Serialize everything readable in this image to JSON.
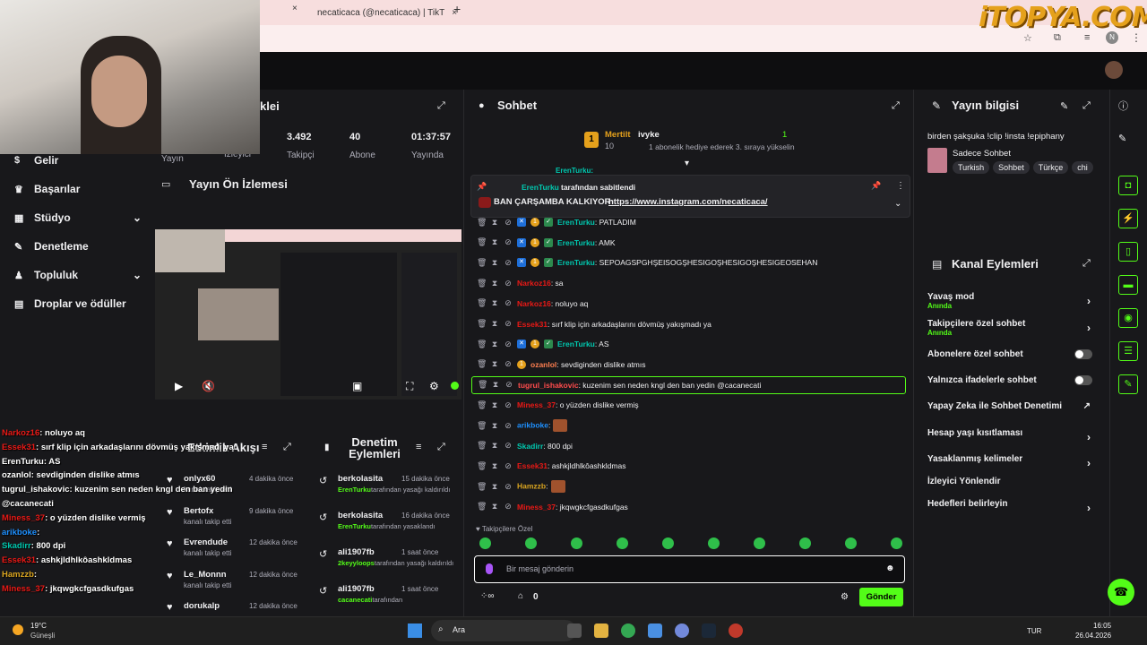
{
  "browser": {
    "tab2_title": "necaticaca (@necaticaca) | TikT",
    "new_tab": "+",
    "close": "×"
  },
  "logo": "iTOPYA.COM",
  "nav": {
    "items": [
      "Gelir",
      "Başarılar",
      "Stüdyo",
      "Denetleme",
      "Topluluk",
      "Droplar ve ödüller"
    ]
  },
  "stats": {
    "heading": "klei",
    "v1": "3.492",
    "l1": "Takipçi",
    "v2": "40",
    "l2": "Abone",
    "v3": "01:37:57",
    "l3": "Yayında",
    "l0": "Yayın",
    "l00": "İzleyici"
  },
  "preview": {
    "title": "Yayın Ön İzlemesi"
  },
  "activity": {
    "title": "Etkinlik Akışı",
    "items": [
      {
        "name": "onlyx60",
        "sub": "kanalı takip etti",
        "time": "4 dakika önce"
      },
      {
        "name": "Bertofx",
        "sub": "kanalı takip etti",
        "time": "9 dakika önce"
      },
      {
        "name": "Evrendude",
        "sub": "kanalı takip etti",
        "time": "12 dakika önce"
      },
      {
        "name": "Le_Monnn",
        "sub": "kanalı takip etti",
        "time": "12 dakika önce"
      },
      {
        "name": "dorukalp",
        "sub": "",
        "time": "12 dakika önce"
      }
    ]
  },
  "modlog": {
    "title": "Denetim Eylemleri",
    "items": [
      {
        "name": "berkolasita",
        "time": "15 dakika önce",
        "actor": "ErenTurku",
        "text": "tarafından yasağı kaldırıldı"
      },
      {
        "name": "berkolasita",
        "time": "16 dakika önce",
        "actor": "ErenTurku",
        "text": "tarafından yasaklandı"
      },
      {
        "name": "ali1907fb",
        "time": "1 saat önce",
        "actor": "2keyyloops",
        "text": "tarafından yasağı kaldırıldı"
      },
      {
        "name": "ali1907fb",
        "time": "1 saat önce",
        "actor": "cacanecati",
        "text": "tarafından"
      }
    ]
  },
  "chat": {
    "title": "Sohbet",
    "top_user": "Mertilt",
    "top_rank": "1",
    "top_count": "10",
    "top_gift_user": "ivyke",
    "top_gift_text": "1 abonelik hediye ederek 3. sıraya yükselin",
    "top_gift_count": "1",
    "pinned_by": "ErenTurku",
    "pinned_suffix": "tarafından sabitlendi",
    "pinned_msg": "BAN ÇARŞAMBA KALKIYOR",
    "pinned_link": "https://www.instagram.com/necaticaca/",
    "partial_user": "ErenTurku:",
    "messages": [
      {
        "user": "ErenTurku",
        "color": "#00c8af",
        "text": ": PATLADIM"
      },
      {
        "user": "ErenTurku",
        "color": "#00c8af",
        "text": ": AMK"
      },
      {
        "user": "ErenTurku",
        "color": "#00c8af",
        "text": ": SEPOAGSPGHŞEISOGŞHESIGOŞHESIGOŞHESIGEOSEHAN"
      },
      {
        "user": "Narkoz16",
        "color": "#e91916",
        "text": ": sa"
      },
      {
        "user": "Narkoz16",
        "color": "#e91916",
        "text": ": noluyo aq"
      },
      {
        "user": "Essek31",
        "color": "#e91916",
        "text": ": sırf klip için arkadaşlarını dövmüş yakışmadı ya"
      },
      {
        "user": "ErenTurku",
        "color": "#00c8af",
        "text": ": AS"
      },
      {
        "user": "ozanlol",
        "color": "#ff7f50",
        "text": ": sevdiginden dislike atmıs"
      },
      {
        "user": "tugrul_ishakovic",
        "color": "#ff4c4c",
        "text": ": kuzenim sen neden kngl den ban yedin @cacanecati"
      },
      {
        "user": "Miness_37",
        "color": "#e91916",
        "text": ": o yüzden dislike vermiş"
      },
      {
        "user": "arikboke",
        "color": "#1e90ff",
        "text": ":"
      },
      {
        "user": "Skadirr",
        "color": "#00c8af",
        "text": ": 800 dpi"
      },
      {
        "user": "Essek31",
        "color": "#e91916",
        "text": ": ashkjldhlkôashkldmas"
      },
      {
        "user": "Hamzzb",
        "color": "#daa520",
        "text": ":"
      },
      {
        "user": "Miness_37",
        "color": "#e91916",
        "text": ": jkqwgkcfgasdkufgas"
      }
    ],
    "followers_only": "Takipçilere Özel",
    "input_placeholder": "Bir mesaj gönderin",
    "points": "0",
    "send": "Gönder"
  },
  "info": {
    "title": "Yayın bilgisi",
    "stream_title": "birden şakşuka !clip !insta !epiphany",
    "category": "Sadece Sohbet",
    "tags": [
      "Turkish",
      "Sohbet",
      "Türkçe",
      "chi"
    ]
  },
  "actions": {
    "title": "Kanal Eylemleri",
    "items": [
      {
        "label": "Yavaş mod",
        "sub": "Anında"
      },
      {
        "label": "Takipçilere özel sohbet",
        "sub": "Anında"
      },
      {
        "label": "Abonelere özel sohbet",
        "sub": ""
      },
      {
        "label": "Yalnızca ifadelerle sohbet",
        "sub": ""
      },
      {
        "label": "Yapay Zeka ile Sohbet Denetimi",
        "sub": ""
      },
      {
        "label": "Hesap yaşı kısıtlaması",
        "sub": ""
      },
      {
        "label": "Yasaklanmış kelimeler",
        "sub": ""
      },
      {
        "label": "İzleyici Yönlendir",
        "sub": ""
      },
      {
        "label": "Hedefleri belirleyin",
        "sub": ""
      }
    ]
  },
  "overlay": {
    "lines": [
      {
        "u": "Narkoz16",
        "c": "#e91916",
        "t": ": noluyo aq"
      },
      {
        "u": "Essek31",
        "c": "#e91916",
        "t": ": sırf klip için arkadaşlarını dövmüş yakışmadı ya"
      },
      {
        "u": "ErenTurku",
        "c": "#fff",
        "t": ": AS"
      },
      {
        "u": "ozanlol",
        "c": "#fff",
        "t": ": sevdiginden dislike atmıs"
      },
      {
        "u": "tugrul_ishakovic",
        "c": "#fff",
        "t": ": kuzenim sen neden kngl den ban yedin"
      },
      {
        "u": "",
        "c": "#fff",
        "t": "@cacanecati"
      },
      {
        "u": "Miness_37",
        "c": "#e91916",
        "t": ": o yüzden dislike vermiş"
      },
      {
        "u": "arikboke",
        "c": "#1e90ff",
        "t": ":"
      },
      {
        "u": "Skadirr",
        "c": "#00c8af",
        "t": ": 800 dpi"
      },
      {
        "u": "Essek31",
        "c": "#e91916",
        "t": ": ashkjldhlkôashkldmas"
      },
      {
        "u": "Hamzzb",
        "c": "#daa520",
        "t": ":"
      },
      {
        "u": "Miness_37",
        "c": "#e91916",
        "t": ": jkqwgkcfgasdkufgas"
      }
    ]
  },
  "taskbar": {
    "weather_temp": "19°C",
    "weather_text": "Güneşli",
    "search": "Ara",
    "lang": "TUR",
    "time": "16:05",
    "date": "26.04.2026"
  },
  "colors": {
    "accent": "#53fc18",
    "bg": "#18181b"
  }
}
